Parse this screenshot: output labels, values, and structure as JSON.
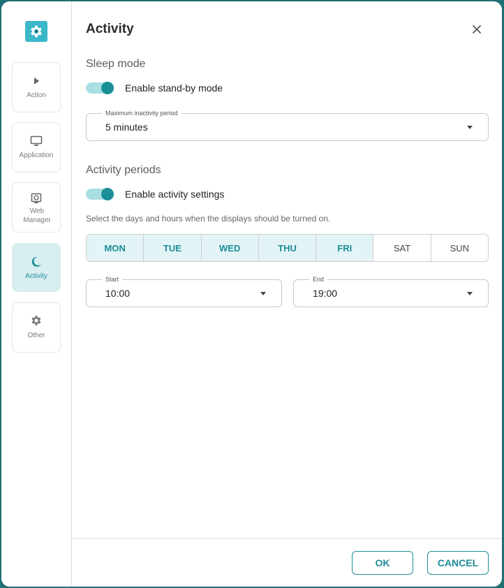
{
  "dialog": {
    "title": "Activity",
    "close_icon": "close-icon"
  },
  "sidebar": {
    "logo_icon": "gear-monitor-icon",
    "items": [
      {
        "label": "Action",
        "icon": "play-icon",
        "active": false
      },
      {
        "label": "Application",
        "icon": "monitor-icon",
        "active": false
      },
      {
        "label": "Web Manager",
        "icon": "web-manager-icon",
        "active": false
      },
      {
        "label": "Activity",
        "icon": "moon-icon",
        "active": true
      },
      {
        "label": "Other",
        "icon": "gear-icon",
        "active": false
      }
    ]
  },
  "sleep_mode": {
    "title": "Sleep mode",
    "toggle_label": "Enable stand-by mode",
    "toggle_on": true,
    "inactivity": {
      "label": "Maximum inactivity period",
      "value": "5 minutes"
    }
  },
  "activity_periods": {
    "title": "Activity periods",
    "toggle_label": "Enable activity settings",
    "toggle_on": true,
    "hint": "Select the days and hours when the displays should be turned on.",
    "days": [
      {
        "label": "MON",
        "selected": true
      },
      {
        "label": "TUE",
        "selected": true
      },
      {
        "label": "WED",
        "selected": true
      },
      {
        "label": "THU",
        "selected": true
      },
      {
        "label": "FRI",
        "selected": true
      },
      {
        "label": "SAT",
        "selected": false
      },
      {
        "label": "SUN",
        "selected": false
      }
    ],
    "start": {
      "label": "Start",
      "value": "10:00"
    },
    "end": {
      "label": "End",
      "value": "19:00"
    }
  },
  "footer": {
    "ok_label": "OK",
    "cancel_label": "CANCEL"
  },
  "colors": {
    "accent": "#1c8d97",
    "accent_light": "#d8eef1",
    "backdrop": "#1f6f73"
  }
}
